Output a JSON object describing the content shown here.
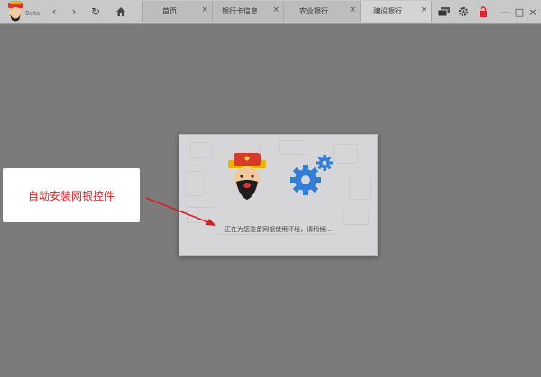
{
  "app": {
    "beta_label": "Beta"
  },
  "tabs": [
    {
      "label": "首页",
      "close": "×"
    },
    {
      "label": "银行卡信息",
      "close": "×"
    },
    {
      "label": "农业银行",
      "close": "×"
    },
    {
      "label": "建设银行",
      "close": "×"
    }
  ],
  "toolbar": {
    "back": "‹",
    "forward": "›",
    "refresh": "↻",
    "minimize": "—",
    "maximize": "□",
    "close": "×"
  },
  "icons": [
    "back-icon",
    "forward-icon",
    "refresh-icon",
    "home-icon",
    "card-icon",
    "gear-icon",
    "lock-icon"
  ],
  "dialog": {
    "status": "正在为您准备网银使用环境，请稍候..."
  },
  "annotation": {
    "text": "自动安装网银控件"
  },
  "colors": {
    "accent_red": "#e02020",
    "gear_blue": "#2f7ed8",
    "lock_red": "#e8202a"
  }
}
